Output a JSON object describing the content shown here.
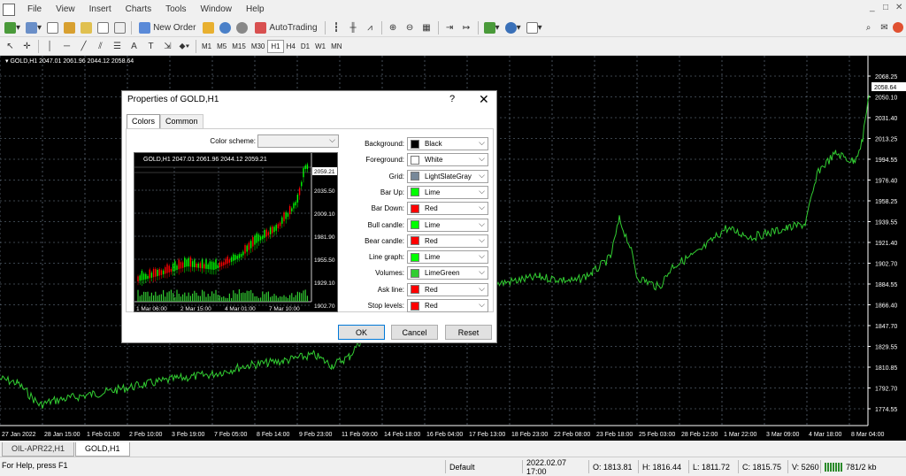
{
  "menubar": {
    "items": [
      "File",
      "View",
      "Insert",
      "Charts",
      "Tools",
      "Window",
      "Help"
    ],
    "win_controls": [
      "_",
      "□",
      "✕"
    ]
  },
  "toolbar": {
    "new_order": "New Order",
    "auto_trading": "AutoTrading"
  },
  "timeframes": [
    "M1",
    "M5",
    "M15",
    "M30",
    "H1",
    "H4",
    "D1",
    "W1",
    "MN"
  ],
  "chart": {
    "title": "GOLD,H1  2047.01 2061.96 2044.12 2058.64",
    "current_price": "2058.64",
    "price_labels": [
      "2068.25",
      "2050.10",
      "2031.40",
      "2013.25",
      "1994.55",
      "1976.40",
      "1958.25",
      "1939.55",
      "1921.40",
      "1902.70",
      "1884.55",
      "1866.40",
      "1847.70",
      "1829.55",
      "1810.85",
      "1792.70",
      "1774.55"
    ],
    "time_labels": [
      "27 Jan 2022",
      "28 Jan 15:00",
      "1 Feb 01:00",
      "2 Feb 10:00",
      "3 Feb 19:00",
      "7 Feb 05:00",
      "8 Feb 14:00",
      "9 Feb 23:00",
      "11 Feb 09:00",
      "14 Feb 18:00",
      "16 Feb 04:00",
      "17 Feb 13:00",
      "18 Feb 23:00",
      "22 Feb 08:00",
      "23 Feb 18:00",
      "25 Feb 03:00",
      "28 Feb 12:00",
      "1 Mar 22:00",
      "3 Mar 09:00",
      "4 Mar 18:00",
      "8 Mar 04:00"
    ],
    "colors": {
      "background": "#000000",
      "grid": "#778899",
      "bull": "#00ff00",
      "line": "#32cd32",
      "text": "#ffffff"
    }
  },
  "tabs": [
    {
      "label": "OIL-APR22,H1",
      "active": false
    },
    {
      "label": "GOLD,H1",
      "active": true
    }
  ],
  "status": {
    "help": "For Help, press F1",
    "profile": "Default",
    "datetime": "2022.02.07 17:00",
    "open": "O: 1813.81",
    "high": "H: 1816.44",
    "low": "L: 1811.72",
    "close": "C: 1815.75",
    "volume": "V: 5260",
    "traffic": "781/2 kb"
  },
  "dialog": {
    "title": "Properties of GOLD,H1",
    "help": "?",
    "close": "✕",
    "tabs": [
      "Colors",
      "Common"
    ],
    "color_scheme_label": "Color scheme:",
    "color_scheme_value": "",
    "fields": [
      {
        "label": "Background:",
        "value": "Black",
        "color": "#000000"
      },
      {
        "label": "Foreground:",
        "value": "White",
        "color": "#ffffff"
      },
      {
        "label": "Grid:",
        "value": "LightSlateGray",
        "color": "#778899"
      },
      {
        "label": "Bar Up:",
        "value": "Lime",
        "color": "#00ff00"
      },
      {
        "label": "Bar Down:",
        "value": "Red",
        "color": "#ff0000"
      },
      {
        "label": "Bull candle:",
        "value": "Lime",
        "color": "#00ff00"
      },
      {
        "label": "Bear candle:",
        "value": "Red",
        "color": "#ff0000"
      },
      {
        "label": "Line graph:",
        "value": "Lime",
        "color": "#00ff00"
      },
      {
        "label": "Volumes:",
        "value": "LimeGreen",
        "color": "#32cd32"
      },
      {
        "label": "Ask line:",
        "value": "Red",
        "color": "#ff0000"
      },
      {
        "label": "Stop levels:",
        "value": "Red",
        "color": "#ff0000"
      }
    ],
    "preview": {
      "title": "GOLD,H1  2047.01 2061.96 2044.12 2059.21",
      "current_price": "2059.21",
      "price_labels": [
        "2035.50",
        "2009.10",
        "1981.90",
        "1955.50",
        "1929.10",
        "1902.70"
      ],
      "time_labels": [
        "1 Mar 06:00",
        "2 Mar 15:00",
        "4 Mar 01:00",
        "7 Mar 10:00"
      ]
    },
    "buttons": {
      "ok": "OK",
      "cancel": "Cancel",
      "reset": "Reset"
    }
  }
}
